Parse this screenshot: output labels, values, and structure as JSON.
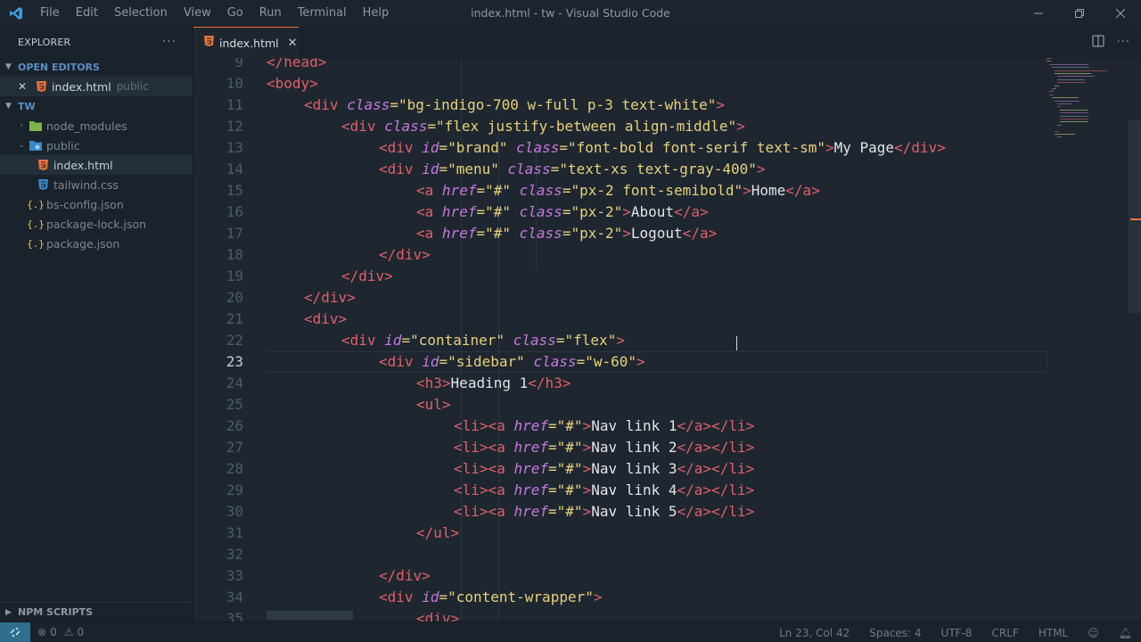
{
  "window": {
    "title": "index.html - tw - Visual Studio Code",
    "menu": [
      "File",
      "Edit",
      "Selection",
      "View",
      "Go",
      "Run",
      "Terminal",
      "Help"
    ]
  },
  "sidebar": {
    "title": "EXPLORER",
    "open_editors_label": "OPEN EDITORS",
    "open_editor": {
      "name": "index.html",
      "folder": "public"
    },
    "workspace_label": "TW",
    "tree": [
      {
        "name": "node_modules",
        "type": "folder"
      },
      {
        "name": "public",
        "type": "folder-open"
      },
      {
        "name": "index.html",
        "type": "html"
      },
      {
        "name": "tailwind.css",
        "type": "css"
      },
      {
        "name": "bs-config.json",
        "type": "json"
      },
      {
        "name": "package-lock.json",
        "type": "json"
      },
      {
        "name": "package.json",
        "type": "json"
      }
    ],
    "npm_scripts_label": "NPM SCRIPTS"
  },
  "editor": {
    "tab_label": "index.html",
    "active_line": 23,
    "lines": [
      {
        "n": "9",
        "indent": 0,
        "code": "</head>"
      },
      {
        "n": "10",
        "indent": 0,
        "code": "<body>"
      },
      {
        "n": "11",
        "indent": 1,
        "code": "<div class=\"bg-indigo-700 w-full p-3 text-white\">"
      },
      {
        "n": "12",
        "indent": 2,
        "code": "<div class=\"flex justify-between align-middle\">"
      },
      {
        "n": "13",
        "indent": 3,
        "code": "<div id=\"brand\" class=\"font-bold font-serif text-sm\">My Page</div>"
      },
      {
        "n": "14",
        "indent": 3,
        "code": "<div id=\"menu\" class=\"text-xs text-gray-400\">"
      },
      {
        "n": "15",
        "indent": 4,
        "code": "<a href=\"#\" class=\"px-2 font-semibold\">Home</a>"
      },
      {
        "n": "16",
        "indent": 4,
        "code": "<a href=\"#\" class=\"px-2\">About</a>"
      },
      {
        "n": "17",
        "indent": 4,
        "code": "<a href=\"#\" class=\"px-2\">Logout</a>"
      },
      {
        "n": "18",
        "indent": 3,
        "code": "</div>"
      },
      {
        "n": "19",
        "indent": 2,
        "code": "</div>"
      },
      {
        "n": "20",
        "indent": 1,
        "code": "</div>"
      },
      {
        "n": "21",
        "indent": 1,
        "code": "<div>"
      },
      {
        "n": "22",
        "indent": 2,
        "code": "<div id=\"container\" class=\"flex\">"
      },
      {
        "n": "23",
        "indent": 3,
        "code": "<div id=\"sidebar\" class=\"w-60\">"
      },
      {
        "n": "24",
        "indent": 4,
        "code": "<h3>Heading 1</h3>"
      },
      {
        "n": "25",
        "indent": 4,
        "code": "<ul>"
      },
      {
        "n": "26",
        "indent": 5,
        "code": "<li><a href=\"#\">Nav link 1</a></li>"
      },
      {
        "n": "27",
        "indent": 5,
        "code": "<li><a href=\"#\">Nav link 2</a></li>"
      },
      {
        "n": "28",
        "indent": 5,
        "code": "<li><a href=\"#\">Nav link 3</a></li>"
      },
      {
        "n": "29",
        "indent": 5,
        "code": "<li><a href=\"#\">Nav link 4</a></li>"
      },
      {
        "n": "30",
        "indent": 5,
        "code": "<li><a href=\"#\">Nav link 5</a></li>"
      },
      {
        "n": "31",
        "indent": 4,
        "code": "</ul>"
      },
      {
        "n": "32",
        "indent": 0,
        "code": ""
      },
      {
        "n": "33",
        "indent": 3,
        "code": "</div>"
      },
      {
        "n": "34",
        "indent": 3,
        "code": "<div id=\"content-wrapper\">"
      },
      {
        "n": "35",
        "indent": 4,
        "code": "<div>"
      }
    ]
  },
  "status": {
    "errors": "0",
    "warnings": "0",
    "position": "Ln 23, Col 42",
    "spaces": "Spaces: 4",
    "encoding": "UTF-8",
    "eol": "CRLF",
    "language": "HTML"
  },
  "colors": {
    "accent": "#e8733a",
    "background": "#1e2730",
    "sidebar": "#1a222b",
    "folder_blue": "#5a8ec4"
  }
}
